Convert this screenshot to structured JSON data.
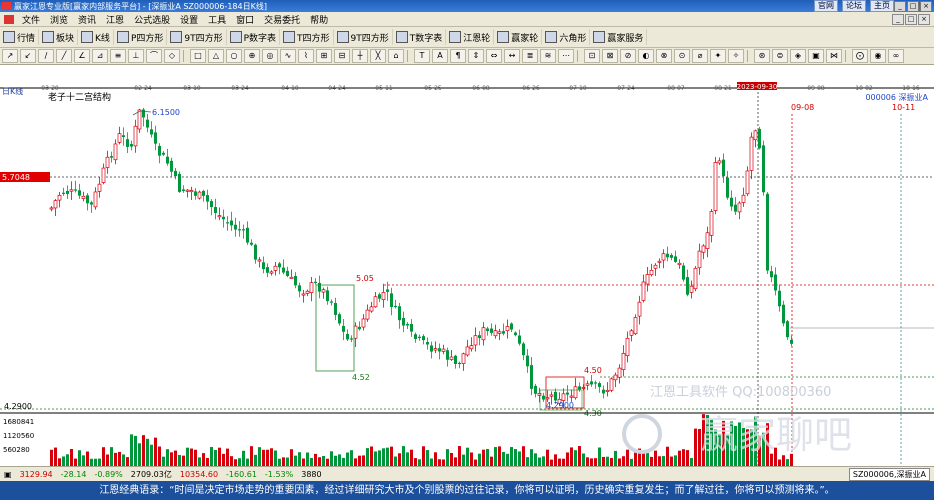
{
  "window": {
    "title": "赢家江恩专业版[赢家内部服务平台] - [深振业A   SZ000006-184日K线]",
    "links": [
      "官网",
      "论坛",
      "主页"
    ],
    "buttons": [
      "_",
      "□",
      "×"
    ]
  },
  "menu": [
    "文件",
    "浏览",
    "资讯",
    "江恩",
    "公式选股",
    "设置",
    "工具",
    "窗口",
    "交易委托",
    "帮助"
  ],
  "toolbar": [
    {
      "label": "行情",
      "icon": "quote-icon"
    },
    {
      "label": "板块",
      "icon": "sector-icon"
    },
    {
      "label": "K线",
      "icon": "kline-icon"
    },
    {
      "label": "P四方形",
      "icon": "p-square-icon"
    },
    {
      "label": "9T四方形",
      "icon": "9t-square-icon"
    },
    {
      "label": "P数字表",
      "icon": "p-table-icon"
    },
    {
      "label": "T四方形",
      "icon": "t-square-icon"
    },
    {
      "label": "9T四方形",
      "icon": "9t-square-icon"
    },
    {
      "label": "T数字表",
      "icon": "t-table-icon"
    },
    {
      "label": "江恩轮",
      "icon": "gann-wheel-icon"
    },
    {
      "label": "赢家轮",
      "icon": "winner-wheel-icon"
    },
    {
      "label": "六角形",
      "icon": "hexagon-icon"
    },
    {
      "label": "赢家服务",
      "icon": "service-icon"
    }
  ],
  "tools": [
    "↗",
    "↙",
    "∕",
    "╱",
    "∠",
    "⊿",
    "≡",
    "⊥",
    "⌒",
    "◇",
    "□",
    "△",
    "○",
    "⊕",
    "◎",
    "∿",
    "⌇",
    "⊞",
    "⊟",
    "┼",
    "╳",
    "⌂",
    "T",
    "A",
    "¶",
    "⇕",
    "⇔",
    "↔",
    "≣",
    "≋",
    "⋯",
    "⊡",
    "⊠",
    "⊘",
    "◐",
    "⊗",
    "⊙",
    "⌀",
    "✦",
    "✧",
    "⊛",
    "⊜",
    "◈",
    "▣",
    "⋈",
    "⨀",
    "◉",
    "∞"
  ],
  "chart": {
    "period_label": "日K线",
    "indicator_title": "老子十二宫结构",
    "stock_label": "000006  深振业A",
    "dates": [
      "03-20",
      "02-24",
      "03-10",
      "03-24",
      "04-10",
      "04-24",
      "05-11",
      "05-25",
      "06-08",
      "06-26",
      "07-10",
      "07-24",
      "08-07",
      "08-21",
      "2023-09-30",
      "09-08",
      "10-02",
      "10-16"
    ],
    "date_markers": [
      "09-08",
      "10-11"
    ],
    "price_labels": {
      "high": "6.1500",
      "left": "5.7048",
      "box1_top": "5.05",
      "box1_low": "4.52",
      "box2_top": "4.50",
      "box2_low": "4.2900",
      "box2_bottom": "4.30",
      "axis_low": "4.2900"
    },
    "volume_ticks": [
      "1680841",
      "1120560",
      "560280"
    ],
    "watermark": "江恩工具软件  QQ:100800360",
    "watermark2": "赢家聊吧",
    "colors": {
      "up": "#d6000c",
      "down": "#00963c",
      "axis": "#000000",
      "box": "#2a8a2a",
      "grid": "#999999",
      "label_red": "#d80000",
      "label_green": "#1a7a1a",
      "blue": "#1e46c8"
    }
  },
  "status": {
    "items": [
      {
        "text": "3129.94",
        "cls": "red"
      },
      {
        "text": "-28.14",
        "cls": "grn"
      },
      {
        "text": "-0.89%",
        "cls": "grn"
      },
      {
        "text": "2709.03亿",
        "cls": ""
      },
      {
        "text": "10354.60",
        "cls": "red"
      },
      {
        "text": "-160.61",
        "cls": "grn"
      },
      {
        "text": "-1.53%",
        "cls": "grn"
      },
      {
        "text": "3880",
        "cls": ""
      }
    ],
    "tab": "SZ000006,深振业A"
  },
  "quote": "江恩经典语录：“时间是决定市场走势的重要因素，经过详细研究大市及个别股票的过往记录，你将可以证明，历史确实重复发生；而了解过往，你将可以预测将来。”。"
}
